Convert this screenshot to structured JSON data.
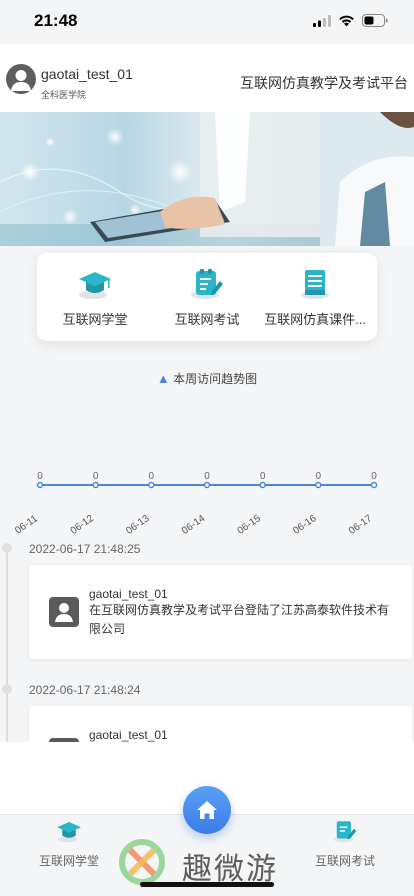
{
  "status_bar": {
    "time": "21:48"
  },
  "header": {
    "user_name": "gaotai_test_01",
    "user_org": "全科医学院",
    "platform_title": "互联网仿真教学及考试平台"
  },
  "cards": [
    {
      "label": "互联网学堂",
      "icon": "graduation-cap-icon"
    },
    {
      "label": "互联网考试",
      "icon": "exam-pencil-icon"
    },
    {
      "label": "互联网仿真课件...",
      "icon": "courseware-book-icon"
    }
  ],
  "chart_data": {
    "type": "line",
    "series": [
      {
        "name": "本周访问趋势图",
        "values": [
          0,
          0,
          0,
          0,
          0,
          0,
          0
        ],
        "color": "#4a86d6"
      }
    ],
    "categories": [
      "06-11",
      "06-12",
      "06-13",
      "06-14",
      "06-15",
      "06-16",
      "06-17"
    ],
    "tick_labels_visible": [
      "06-11",
      "06-12",
      "06-13",
      "06-14",
      "06-15",
      "06-16",
      "06-17"
    ],
    "data_labels": [
      "0",
      "0",
      "0",
      "0",
      "0",
      "0",
      "0"
    ],
    "legend": "top-center",
    "grid": false
  },
  "timeline": [
    {
      "time": "2022-06-17 21:48:25",
      "name": "gaotai_test_01",
      "message": "在互联网仿真教学及考试平台登陆了江苏高泰软件技术有限公司"
    },
    {
      "time": "2022-06-17 21:48:24",
      "name": "gaotai_test_01",
      "message": ""
    }
  ],
  "tabbar": {
    "left_label": "互联网学堂",
    "right_label": "互联网考试"
  },
  "watermark": {
    "text": "趣微游"
  },
  "colors": {
    "accent": "#3b7be8",
    "teal": "#2bb5c9",
    "line": "#4a86d6"
  }
}
